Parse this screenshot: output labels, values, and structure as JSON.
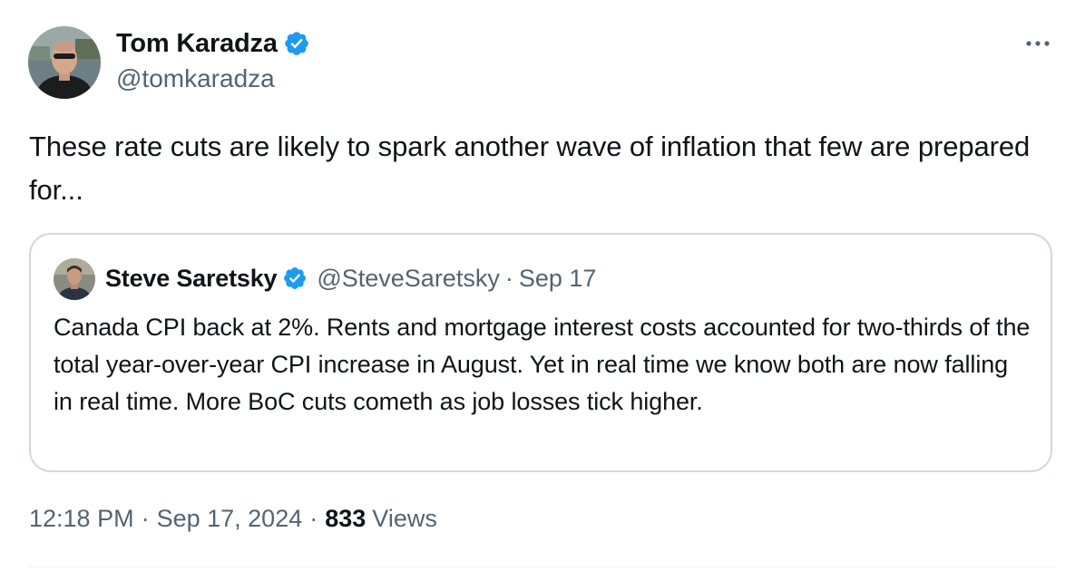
{
  "tweet": {
    "author": {
      "name": "Tom Karadza",
      "handle": "@tomkaradza",
      "verified": true
    },
    "text": "These rate cuts are likely to spark another wave of inflation that few are prepared for...",
    "more_icon": "more-horizontal-icon",
    "quoted": {
      "author_name": "Steve Saretsky",
      "author_handle": "@SteveSaretsky",
      "separator": "·",
      "date": "Sep 17",
      "verified": true,
      "text": "Canada CPI back at 2%. Rents and mortgage interest costs accounted for two-thirds of the total year-over-year CPI increase in August. Yet in real time we know both are now falling in real time. More BoC cuts cometh as job losses tick higher."
    },
    "meta": {
      "time": "12:18 PM",
      "separator": "·",
      "date": "Sep 17, 2024",
      "views_count": "833",
      "views_label": "Views"
    }
  },
  "colors": {
    "verified_blue": "#1d9bf0",
    "secondary_text": "#536471",
    "border": "#cfd9de"
  }
}
